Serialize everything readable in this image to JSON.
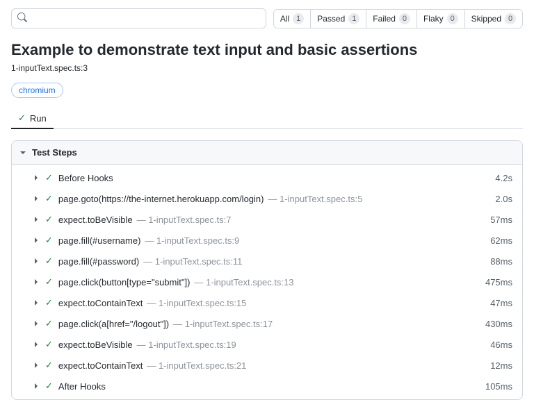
{
  "search": {
    "placeholder": ""
  },
  "filters": [
    {
      "label": "All",
      "count": 1
    },
    {
      "label": "Passed",
      "count": 1
    },
    {
      "label": "Failed",
      "count": 0
    },
    {
      "label": "Flaky",
      "count": 0
    },
    {
      "label": "Skipped",
      "count": 0
    }
  ],
  "title": "Example to demonstrate text input and basic assertions",
  "file_location": "1-inputText.spec.ts:3",
  "browser_tag": "chromium",
  "tab": {
    "label": "Run"
  },
  "panel_title": "Test Steps",
  "steps": [
    {
      "name": "Before Hooks",
      "src": null,
      "duration": "4.2s"
    },
    {
      "name": "page.goto(https://the-internet.herokuapp.com/login)",
      "src": "1-inputText.spec.ts:5",
      "duration": "2.0s"
    },
    {
      "name": "expect.toBeVisible",
      "src": "1-inputText.spec.ts:7",
      "duration": "57ms"
    },
    {
      "name": "page.fill(#username)",
      "src": "1-inputText.spec.ts:9",
      "duration": "62ms"
    },
    {
      "name": "page.fill(#password)",
      "src": "1-inputText.spec.ts:11",
      "duration": "88ms"
    },
    {
      "name": "page.click(button[type=\"submit\"])",
      "src": "1-inputText.spec.ts:13",
      "duration": "475ms"
    },
    {
      "name": "expect.toContainText",
      "src": "1-inputText.spec.ts:15",
      "duration": "47ms"
    },
    {
      "name": "page.click(a[href=\"/logout\"])",
      "src": "1-inputText.spec.ts:17",
      "duration": "430ms"
    },
    {
      "name": "expect.toBeVisible",
      "src": "1-inputText.spec.ts:19",
      "duration": "46ms"
    },
    {
      "name": "expect.toContainText",
      "src": "1-inputText.spec.ts:21",
      "duration": "12ms"
    },
    {
      "name": "After Hooks",
      "src": null,
      "duration": "105ms"
    }
  ]
}
